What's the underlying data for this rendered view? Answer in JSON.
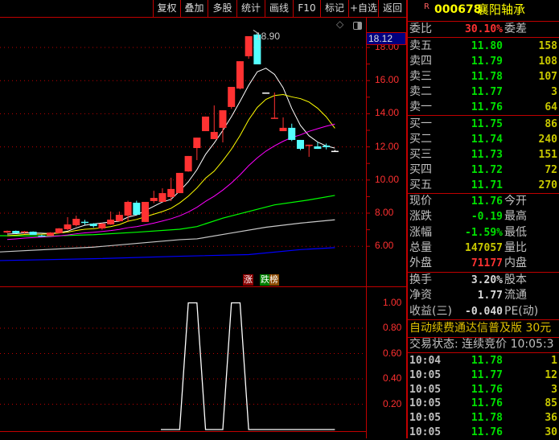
{
  "toolbar": [
    "复权",
    "叠加",
    "多股",
    "统计",
    "画线",
    "F10",
    "标记",
    "+自选",
    "返回"
  ],
  "chart_icons": [
    "diamond-icon",
    "layout-toggle-icon"
  ],
  "axis": {
    "labels": [
      "18.00",
      "16.00",
      "14.00",
      "12.00",
      "10.00",
      "8.00",
      "6.00"
    ],
    "current_box": "18.12",
    "lower_labels": [
      "1.00",
      "0.80",
      "0.60",
      "0.40",
      "0.20"
    ]
  },
  "max_label": "18.90",
  "tags": {
    "rise": "涨",
    "list": "跌榜"
  },
  "colors": {
    "up": "#ff3232",
    "down": "#54ffff",
    "ma5": "#ffffff",
    "ma10": "#ffff00",
    "ma20": "#ff00ff",
    "ma_green": "#00ff00",
    "ma_gray": "#c8c8c8",
    "ma_blue": "#0000ff",
    "grid": "#c00000"
  },
  "chart_data": {
    "type": "candlestick",
    "ylim": [
      5.5,
      19.0
    ],
    "yticks": [
      18,
      16,
      14,
      12,
      10,
      8,
      6
    ],
    "candles": [
      [
        6.83,
        6.95,
        6.8,
        6.93
      ],
      [
        6.93,
        6.95,
        6.79,
        6.79
      ],
      [
        6.85,
        6.92,
        6.75,
        6.9
      ],
      [
        6.88,
        6.9,
        6.69,
        6.69
      ],
      [
        6.65,
        6.7,
        6.58,
        6.64
      ],
      [
        6.64,
        6.85,
        6.64,
        6.83
      ],
      [
        6.79,
        7.1,
        6.79,
        7.08
      ],
      [
        7.03,
        7.76,
        6.98,
        7.32
      ],
      [
        7.27,
        7.85,
        7.2,
        7.66
      ],
      [
        7.48,
        7.6,
        7.3,
        7.47
      ],
      [
        7.37,
        7.4,
        7.12,
        7.22
      ],
      [
        7.08,
        7.4,
        7.0,
        7.37
      ],
      [
        7.32,
        8.1,
        7.3,
        7.61
      ],
      [
        7.51,
        8.1,
        7.5,
        7.9
      ],
      [
        7.85,
        8.75,
        7.47,
        8.68
      ],
      [
        8.63,
        8.75,
        7.9,
        7.9
      ],
      [
        7.47,
        8.68,
        7.47,
        8.68
      ],
      [
        8.73,
        9.35,
        8.6,
        8.92
      ],
      [
        8.68,
        9.5,
        8.68,
        9.21
      ],
      [
        8.97,
        10.14,
        8.73,
        9.46
      ],
      [
        9.21,
        10.43,
        9.21,
        10.43
      ],
      [
        10.52,
        11.45,
        10.5,
        11.45
      ],
      [
        11.93,
        12.56,
        11.2,
        12.56
      ],
      [
        12.95,
        13.83,
        12.95,
        13.83
      ],
      [
        12.47,
        14.5,
        12.47,
        12.9
      ],
      [
        13.15,
        14.21,
        12.27,
        14.21
      ],
      [
        14.41,
        15.62,
        14.3,
        15.62
      ],
      [
        15.52,
        17.17,
        15.47,
        17.17
      ],
      [
        17.47,
        18.68,
        17.32,
        18.68
      ],
      [
        18.78,
        18.9,
        16.98,
        16.98
      ],
      [
        15.28,
        15.28,
        15.28,
        15.28
      ],
      [
        13.73,
        15.28,
        13.73,
        13.76
      ],
      [
        12.95,
        13.78,
        12.95,
        13.15
      ],
      [
        13.15,
        13.4,
        12.35,
        12.42
      ],
      [
        12.42,
        12.42,
        11.8,
        11.88
      ],
      [
        12.08,
        12.13,
        11.4,
        12.13
      ],
      [
        12.03,
        12.3,
        11.88,
        11.88
      ],
      [
        12.08,
        12.2,
        11.85,
        11.98
      ],
      [
        11.76,
        11.82,
        11.7,
        11.76
      ]
    ],
    "pre_closes": [
      5.9,
      5.95,
      6.0,
      6.05,
      6.1,
      6.15,
      6.2,
      6.25,
      6.3,
      6.35,
      6.4,
      6.45,
      6.5,
      6.55,
      6.6,
      6.62,
      6.65,
      6.68,
      6.7,
      6.72
    ],
    "long_mas": [
      {
        "name": "MA-green",
        "idx": [
          0,
          5,
          10,
          15,
          20,
          22,
          25,
          28,
          31,
          35,
          38
        ],
        "values": [
          6.64,
          6.62,
          6.7,
          6.85,
          7.03,
          7.19,
          7.7,
          8.1,
          8.5,
          8.8,
          9.07
        ]
      },
      {
        "name": "MA-gray",
        "idx": [
          0,
          10,
          20,
          22,
          26,
          30,
          34,
          38
        ],
        "values": [
          5.66,
          5.95,
          6.4,
          6.45,
          6.8,
          7.15,
          7.4,
          7.6
        ]
      },
      {
        "name": "MA-blue",
        "idx": [
          0,
          10,
          20,
          28,
          34,
          38
        ],
        "values": [
          5.14,
          5.25,
          5.4,
          5.5,
          5.8,
          5.92
        ]
      }
    ],
    "lower": {
      "ylim": [
        0,
        1
      ],
      "start_idx": 18,
      "values": [
        0,
        0,
        0,
        1,
        1,
        0,
        0,
        0,
        1,
        1,
        0,
        0,
        0,
        0,
        0,
        0,
        0,
        0,
        0,
        0,
        0
      ]
    }
  },
  "quote": {
    "code": "000678",
    "name": "襄阳轴承",
    "badge": "R",
    "weibi_label": "委比",
    "weibi": "30.10%",
    "weicha_label": "委差",
    "sell": [
      {
        "label": "卖五",
        "price": "11.80",
        "vol": "158"
      },
      {
        "label": "卖四",
        "price": "11.79",
        "vol": "108"
      },
      {
        "label": "卖三",
        "price": "11.78",
        "vol": "107"
      },
      {
        "label": "卖二",
        "price": "11.77",
        "vol": "3"
      },
      {
        "label": "卖一",
        "price": "11.76",
        "vol": "64"
      }
    ],
    "buy": [
      {
        "label": "买一",
        "price": "11.75",
        "vol": "86"
      },
      {
        "label": "买二",
        "price": "11.74",
        "vol": "240"
      },
      {
        "label": "买三",
        "price": "11.73",
        "vol": "151"
      },
      {
        "label": "买四",
        "price": "11.72",
        "vol": "72"
      },
      {
        "label": "买五",
        "price": "11.71",
        "vol": "270"
      }
    ],
    "stats": [
      {
        "label": "现价",
        "value": "11.76",
        "label2": "今开"
      },
      {
        "label": "涨跌",
        "value": "-0.19",
        "label2": "最高"
      },
      {
        "label": "涨幅",
        "value": "-1.59%",
        "label2": "最低"
      },
      {
        "label": "总量",
        "value": "147057",
        "label2": "量比"
      },
      {
        "label": "外盘",
        "value": "71177",
        "label2": "内盘"
      }
    ],
    "stats2": [
      {
        "label": "换手",
        "value": "3.20%",
        "label2": "股本"
      },
      {
        "label": "净资",
        "value": "1.77",
        "label2": "流通"
      },
      {
        "label": "收益(三)",
        "value": "-0.040",
        "label2": "PE(动)"
      }
    ],
    "promo": "自动续费通达信普及版  30元",
    "status": "交易状态: 连续竞价 10:05:3",
    "ticks": [
      {
        "time": "10:04",
        "price": "11.78",
        "vol": "1"
      },
      {
        "time": "10:05",
        "price": "11.77",
        "vol": "12"
      },
      {
        "time": "10:05",
        "price": "11.76",
        "vol": "3"
      },
      {
        "time": "10:05",
        "price": "11.76",
        "vol": "85"
      },
      {
        "time": "10:05",
        "price": "11.78",
        "vol": "36"
      },
      {
        "time": "10:05",
        "price": "11.76",
        "vol": "30"
      }
    ]
  }
}
